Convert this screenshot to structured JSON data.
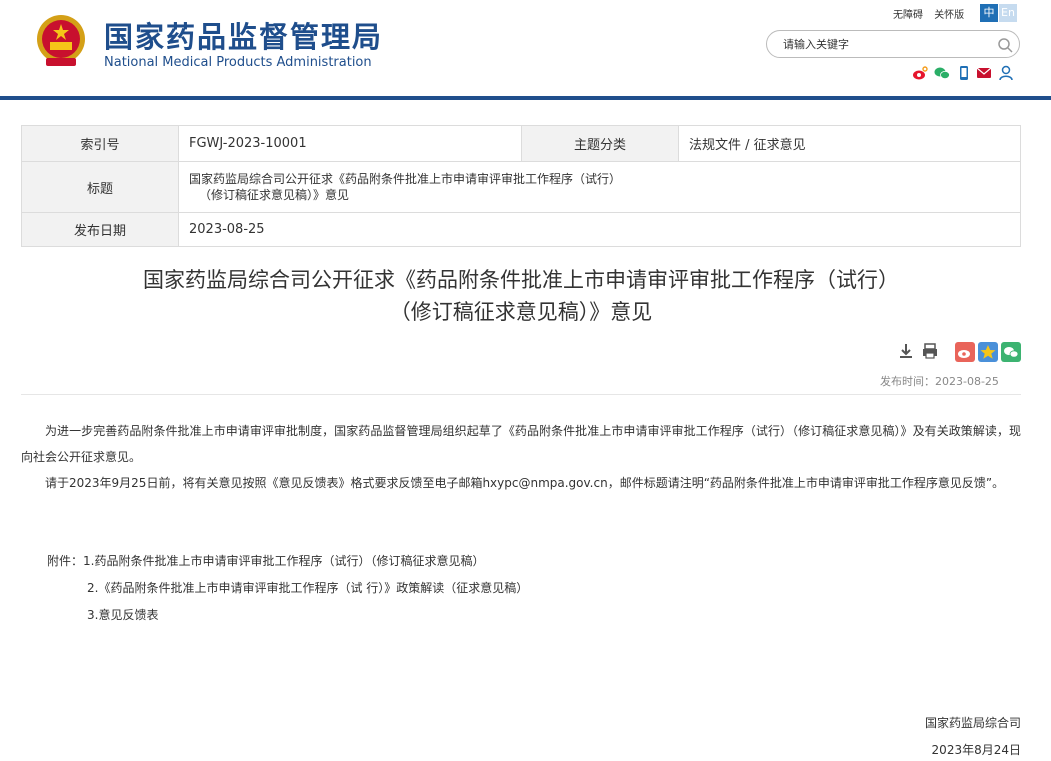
{
  "header": {
    "site_name": "国家药品监督管理局",
    "site_name_en": "National Medical Products Administration",
    "top_links": [
      "无障碍",
      "关怀版"
    ],
    "lang_zh": "中",
    "lang_en": "En",
    "search_placeholder": "请输入关键字",
    "icons": [
      "search-icon",
      "weibo-icon",
      "wechat-icon",
      "mobile-icon",
      "email-icon",
      "user-icon"
    ],
    "brand_color": "#1f4e8c"
  },
  "meta": {
    "index_label": "索引号",
    "index_value": "FGWJ-2023-10001",
    "topic_label": "主题分类",
    "topic_value": "法规文件 / 征求意见",
    "title_label": "标题",
    "title_value_line1": "国家药监局综合司公开征求《药品附条件批准上市申请审评审批工作程序（试行）",
    "title_value_line2": "（修订稿征求意见稿）》意见",
    "date_label": "发布日期",
    "date_value": "2023-08-25"
  },
  "article": {
    "title_line1": "国家药监局综合司公开征求《药品附条件批准上市申请审评审批工作程序（试行）",
    "title_line2": "（修订稿征求意见稿）》意见",
    "pub_label": "发布时间：",
    "pub_value": "2023-08-25",
    "para1": "为进一步完善药品附条件批准上市申请审评审批制度，国家药品监督管理局组织起草了《药品附条件批准上市申请审评审批工作程序（试行）（修订稿征求意见稿）》及有关政策解读，现向社会公开征求意见。",
    "para2": "请于2023年9月25日前，将有关意见按照《意见反馈表》格式要求反馈至电子邮箱hxypc@nmpa.gov.cn，邮件标题请注明“药品附条件批准上市申请审评审批工作程序意见反馈”。",
    "attach_label": "附件：",
    "attach_items": [
      "1.药品附条件批准上市申请审评审批工作程序（试行）（修订稿征求意见稿）",
      "2.《药品附条件批准上市申请审评审批工作程序（试 行）》政策解读（征求意见稿）",
      "3.意见反馈表"
    ],
    "signer": "国家药监局综合司",
    "sign_date": "2023年8月24日"
  }
}
